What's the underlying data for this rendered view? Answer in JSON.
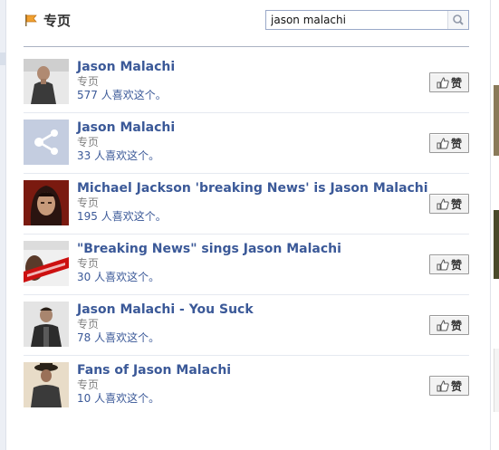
{
  "header": {
    "title": "专页",
    "flag_icon": "flag-icon",
    "search": {
      "value": "jason malachi",
      "icon": "search-icon"
    }
  },
  "results": [
    {
      "name": "Jason Malachi",
      "category": "专页",
      "likes": "577 人喜欢这个。",
      "like_label": "赞"
    },
    {
      "name": "Jason Malachi",
      "category": "专页",
      "likes": "33 人喜欢这个。",
      "like_label": "赞"
    },
    {
      "name": "Michael Jackson 'breaking News' is Jason Malachi",
      "category": "专页",
      "likes": "195 人喜欢这个。",
      "like_label": "赞"
    },
    {
      "name": "\"Breaking News\" sings Jason Malachi",
      "category": "专页",
      "likes": "30 人喜欢这个。",
      "like_label": "赞"
    },
    {
      "name": "Jason Malachi - You Suck",
      "category": "专页",
      "likes": "78 人喜欢这个。",
      "like_label": "赞"
    },
    {
      "name": "Fans of Jason Malachi",
      "category": "专页",
      "likes": "10 人喜欢这个。",
      "like_label": "赞"
    }
  ],
  "colors": {
    "link": "#3b5998",
    "muted": "#808080",
    "rule": "#aab2c2"
  }
}
